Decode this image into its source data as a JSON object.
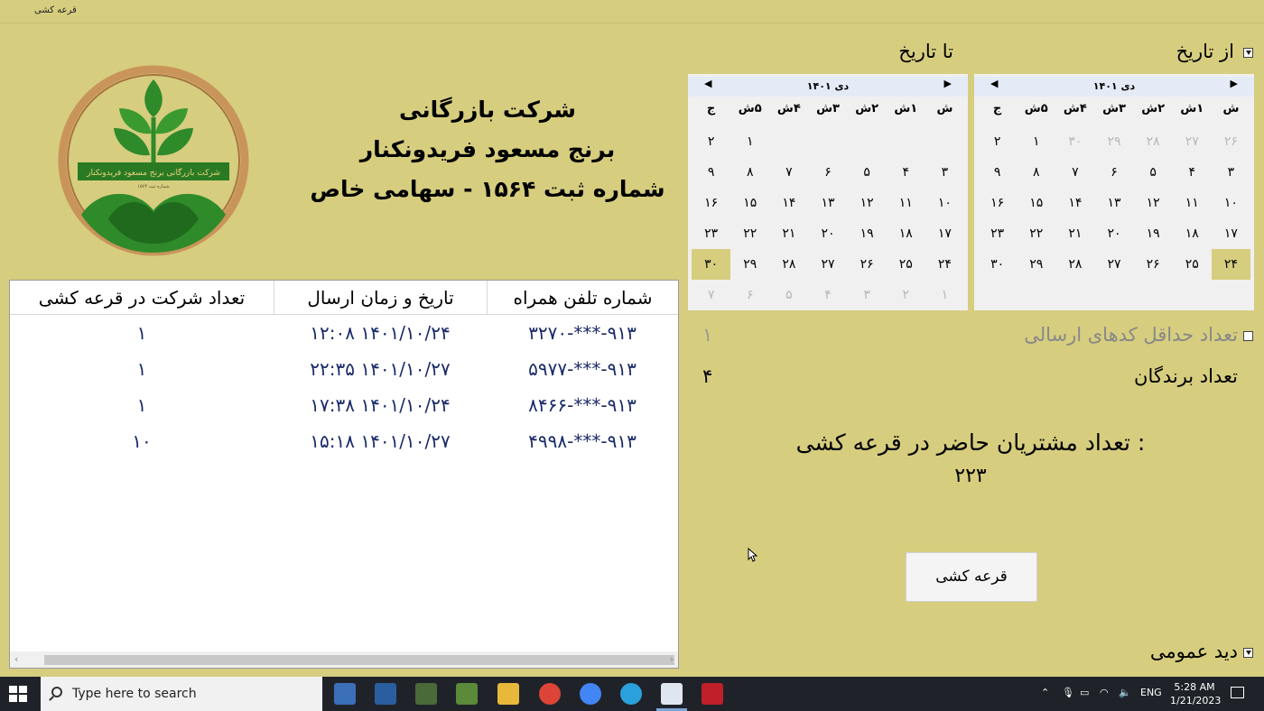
{
  "window": {
    "title": "قرعه کشی"
  },
  "from_date": {
    "label": "از تاریخ",
    "checked": true
  },
  "to_date": {
    "label": "تا تاریخ"
  },
  "company": {
    "line1": "شرکت بازرگانی",
    "line2": "برنج مسعود فریدونکنار",
    "line3": "شماره ثبت ۱۵۶۴ - سهامی خاص",
    "logo_text": "شرکت بازرگانی برنج مسعود فریدونکنار",
    "logo_subtext": "شماره ثبت ۱۵۶۴"
  },
  "calendar_days": [
    "ش",
    "۱ش",
    "۲ش",
    "۳ش",
    "۴ش",
    "۵ش",
    "ج"
  ],
  "calendar_from": {
    "month": "دی ۱۴۰۱",
    "cells": [
      {
        "d": "۲۶",
        "dim": true
      },
      {
        "d": "۲۷",
        "dim": true
      },
      {
        "d": "۲۸",
        "dim": true
      },
      {
        "d": "۲۹",
        "dim": true
      },
      {
        "d": "۳۰",
        "dim": true
      },
      {
        "d": "۱"
      },
      {
        "d": "۲"
      },
      {
        "d": "۳"
      },
      {
        "d": "۴"
      },
      {
        "d": "۵"
      },
      {
        "d": "۶"
      },
      {
        "d": "۷"
      },
      {
        "d": "۸"
      },
      {
        "d": "۹"
      },
      {
        "d": "۱۰"
      },
      {
        "d": "۱۱"
      },
      {
        "d": "۱۲"
      },
      {
        "d": "۱۳"
      },
      {
        "d": "۱۴"
      },
      {
        "d": "۱۵"
      },
      {
        "d": "۱۶"
      },
      {
        "d": "۱۷"
      },
      {
        "d": "۱۸"
      },
      {
        "d": "۱۹"
      },
      {
        "d": "۲۰"
      },
      {
        "d": "۲۱"
      },
      {
        "d": "۲۲"
      },
      {
        "d": "۲۳"
      },
      {
        "d": "۲۴",
        "sel": true
      },
      {
        "d": "۲۵"
      },
      {
        "d": "۲۶"
      },
      {
        "d": "۲۷"
      },
      {
        "d": "۲۸"
      },
      {
        "d": "۲۹"
      },
      {
        "d": "۳۰"
      }
    ]
  },
  "calendar_to": {
    "month": "دی ۱۴۰۱",
    "cells": [
      {
        "d": ""
      },
      {
        "d": ""
      },
      {
        "d": ""
      },
      {
        "d": ""
      },
      {
        "d": ""
      },
      {
        "d": "۱"
      },
      {
        "d": "۲"
      },
      {
        "d": "۳"
      },
      {
        "d": "۴"
      },
      {
        "d": "۵"
      },
      {
        "d": "۶"
      },
      {
        "d": "۷"
      },
      {
        "d": "۸"
      },
      {
        "d": "۹"
      },
      {
        "d": "۱۰"
      },
      {
        "d": "۱۱"
      },
      {
        "d": "۱۲"
      },
      {
        "d": "۱۳"
      },
      {
        "d": "۱۴"
      },
      {
        "d": "۱۵"
      },
      {
        "d": "۱۶"
      },
      {
        "d": "۱۷"
      },
      {
        "d": "۱۸"
      },
      {
        "d": "۱۹"
      },
      {
        "d": "۲۰"
      },
      {
        "d": "۲۱"
      },
      {
        "d": "۲۲"
      },
      {
        "d": "۲۳"
      },
      {
        "d": "۲۴"
      },
      {
        "d": "۲۵"
      },
      {
        "d": "۲۶"
      },
      {
        "d": "۲۷"
      },
      {
        "d": "۲۸"
      },
      {
        "d": "۲۹"
      },
      {
        "d": "۳۰",
        "sel": true
      },
      {
        "d": "۱",
        "dim": true
      },
      {
        "d": "۲",
        "dim": true
      },
      {
        "d": "۳",
        "dim": true
      },
      {
        "d": "۴",
        "dim": true
      },
      {
        "d": "۵",
        "dim": true
      },
      {
        "d": "۶",
        "dim": true
      },
      {
        "d": "۷",
        "dim": true
      }
    ]
  },
  "min_codes": {
    "label": "تعداد حداقل کدهای ارسالی",
    "value": "۱",
    "checked": false
  },
  "winners": {
    "label": "تعداد برندگان",
    "value": "۴"
  },
  "participants": {
    "label": "تعداد مشتریان حاضر در قرعه کشی :",
    "value": "۲۲۳"
  },
  "draw_button": "قرعه کشی",
  "overview": {
    "label": "دید عمومی",
    "checked": true
  },
  "table": {
    "headers": [
      "شماره تلفن همراه",
      "تاریخ و زمان ارسال",
      "تعداد شرکت در قرعه کشی"
    ],
    "rows": [
      [
        "۹۱۳-***-۳۲۷۰",
        "۱۴۰۱/۱۰/۲۴ ۱۲:۰۸",
        "۱"
      ],
      [
        "۹۱۳-***-۵۹۷۷",
        "۱۴۰۱/۱۰/۲۷ ۲۲:۳۵",
        "۱"
      ],
      [
        "۹۱۳-***-۸۴۶۶",
        "۱۴۰۱/۱۰/۲۴ ۱۷:۳۸",
        "۱"
      ],
      [
        "۹۱۳-***-۴۹۹۸",
        "۱۴۰۱/۱۰/۲۷ ۱۵:۱۸",
        "۱۰"
      ]
    ]
  },
  "taskbar": {
    "search_placeholder": "Type here to search",
    "language": "ENG",
    "time": "5:28 AM",
    "date": "1/21/2023"
  }
}
